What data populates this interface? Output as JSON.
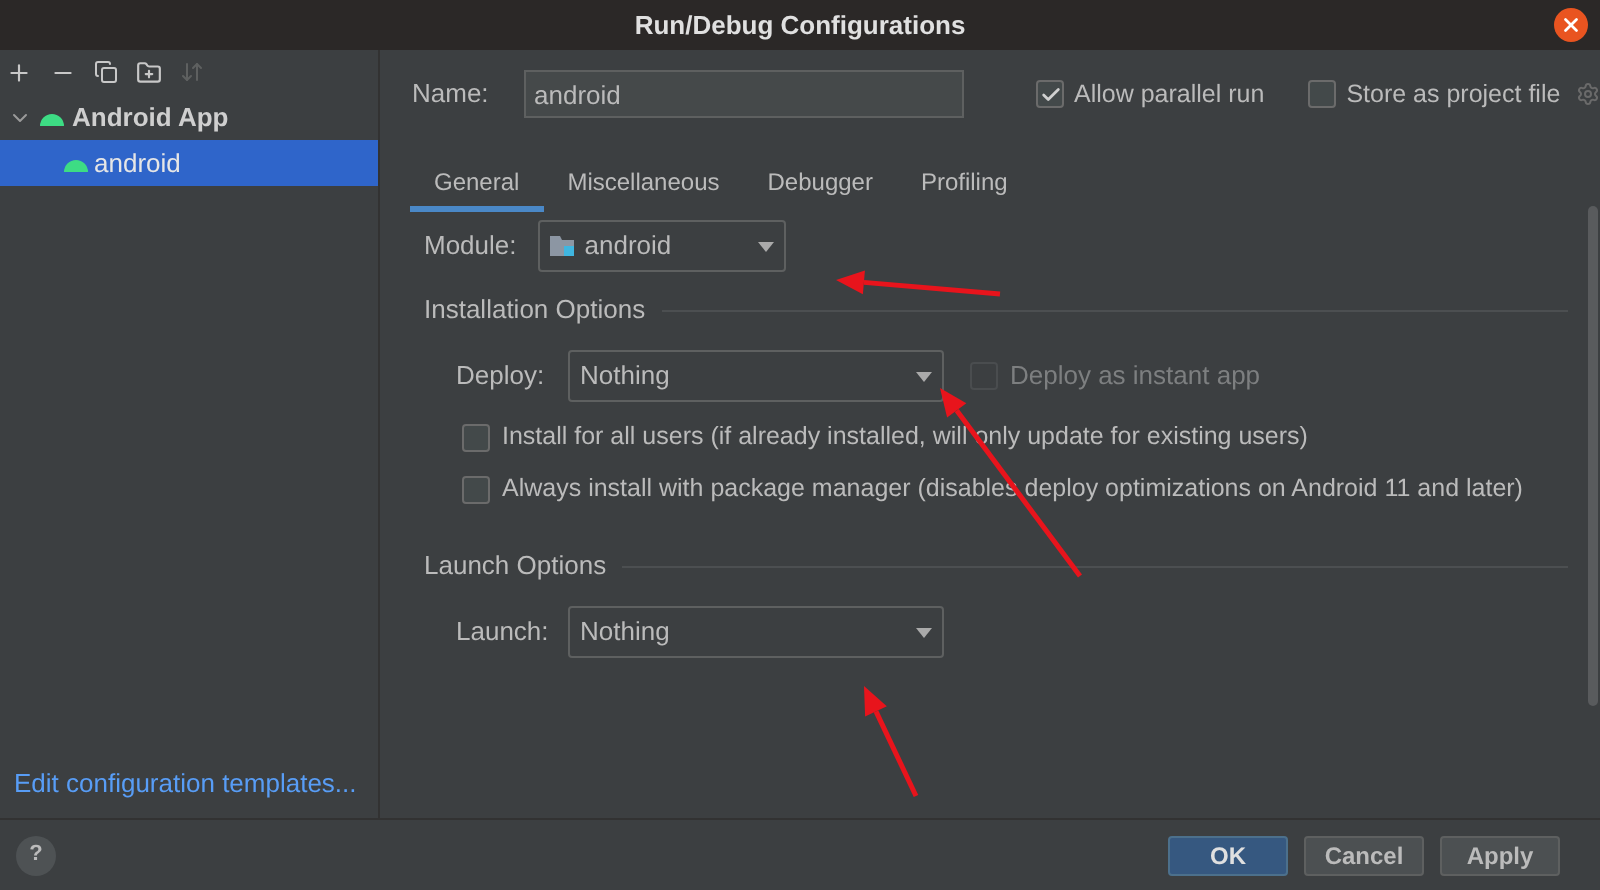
{
  "window": {
    "title": "Run/Debug Configurations"
  },
  "sidebar": {
    "tree": [
      {
        "label": "Android App",
        "expanded": true,
        "selected": false,
        "children": [
          {
            "label": "android",
            "selected": true
          }
        ]
      }
    ],
    "footer_link": "Edit configuration templates..."
  },
  "name_field": {
    "label": "Name:",
    "value": "android"
  },
  "allow_parallel_run": {
    "label": "Allow parallel run",
    "checked": true
  },
  "store_as_project_file": {
    "label": "Store as project file",
    "checked": false
  },
  "tabs": [
    {
      "label": "General",
      "selected": true
    },
    {
      "label": "Miscellaneous",
      "selected": false
    },
    {
      "label": "Debugger",
      "selected": false
    },
    {
      "label": "Profiling",
      "selected": false
    }
  ],
  "module": {
    "label": "Module:",
    "value": "android"
  },
  "installation_options": {
    "title": "Installation Options",
    "deploy": {
      "label": "Deploy:",
      "value": "Nothing"
    },
    "instant_app": {
      "label": "Deploy as instant app",
      "checked": false,
      "disabled": true
    },
    "checkboxes": [
      {
        "label": "Install for all users (if already installed, will only update for existing users)",
        "checked": false
      },
      {
        "label": "Always install with package manager (disables deploy optimizations on Android 11 and later)",
        "checked": false
      }
    ]
  },
  "launch_options": {
    "title": "Launch Options",
    "launch": {
      "label": "Launch:",
      "value": "Nothing"
    }
  },
  "help_button": "?",
  "buttons": [
    {
      "label": "OK",
      "kind": "primary"
    },
    {
      "label": "Cancel",
      "kind": "secondary"
    },
    {
      "label": "Apply",
      "kind": "secondary"
    }
  ]
}
